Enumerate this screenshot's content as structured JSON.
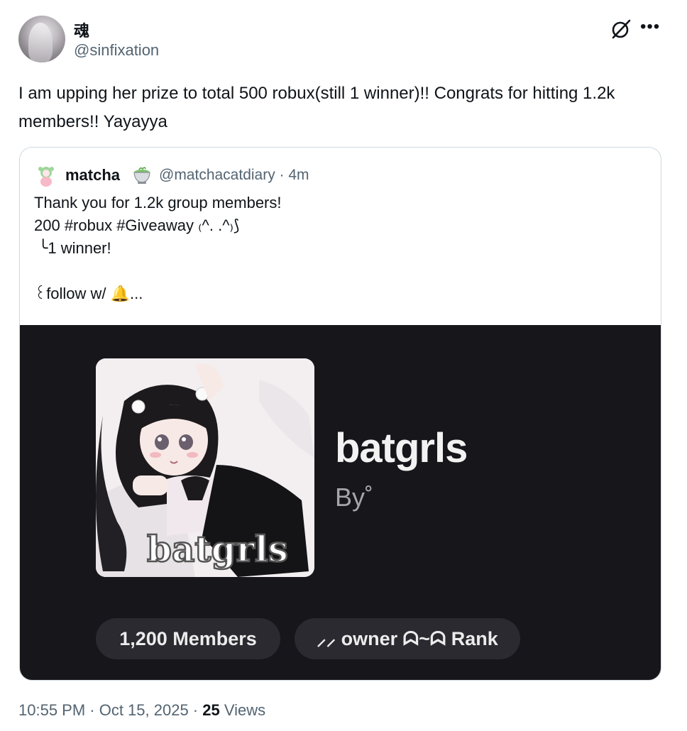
{
  "author": {
    "display_name": "魂",
    "handle": "@sinfixation",
    "avatar_icon": "avatar-photo"
  },
  "header_icons": [
    "grok-slash-icon",
    "more-horizontal-icon"
  ],
  "tweet": {
    "text": "I am upping her prize to total 500 robux(still 1 winner)!! Congrats for hitting 1.2k members!! Yayayya"
  },
  "quote": {
    "display_name": "matcha",
    "name_emoji": "🍵",
    "handle_time": "@matchacatdiary · 4m",
    "text": "Thank you for 1.2k group members!\n200 #robux #Giveaway ₍^. .^₎⟆\n ╰1 winner!\n\n꒰follow w/ 🔔...",
    "media": {
      "group_name": "batgrls",
      "by_label": "By˚",
      "thumbnail_caption": "batgrls",
      "members_pill": "1,200 Members",
      "rank_pill": "⸝⸝ owner ᗣ~ᗣ Rank"
    }
  },
  "meta": {
    "timestamp": "10:55 PM · Oct 15, 2025 · ",
    "views_count": "25",
    "views_label": " Views"
  },
  "colors": {
    "text": "#0f1419",
    "secondary": "#536471",
    "media_bg": "#17161b",
    "pill_bg": "#2a2a30"
  }
}
